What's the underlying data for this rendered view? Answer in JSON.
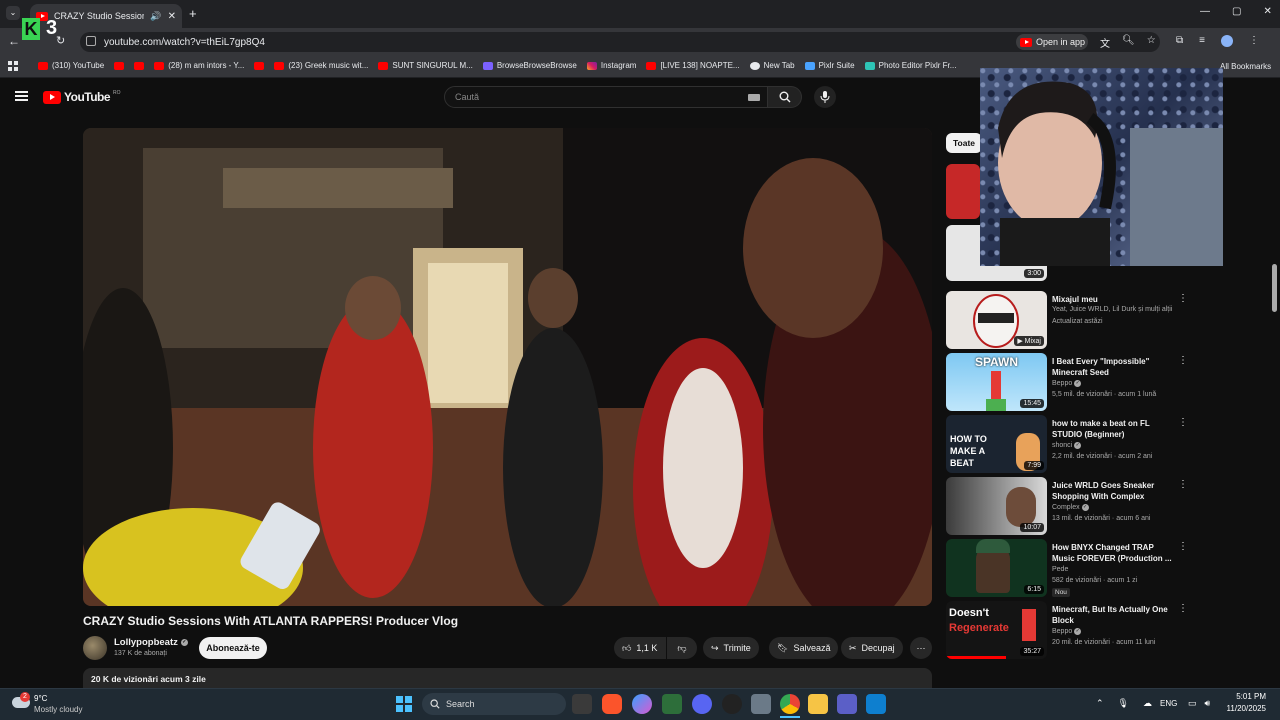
{
  "browser": {
    "tab_title": "CRAZY Studio Sessions With ...",
    "url": "youtube.com/watch?v=thEiL7gp8Q4",
    "open_in_app": "Open in app",
    "all_bookmarks": "All Bookmarks",
    "bookmarks": [
      {
        "label": "(310) YouTube",
        "icon": "youtube-icon"
      },
      {
        "label": "",
        "icon": "youtube-icon"
      },
      {
        "label": "",
        "icon": "youtube-icon"
      },
      {
        "label": "(28) m am intors - Y...",
        "icon": "youtube-icon"
      },
      {
        "label": "",
        "icon": "youtube-icon"
      },
      {
        "label": "(23) Greek music wit...",
        "icon": "youtube-icon"
      },
      {
        "label": "SUNT SINGURUL M...",
        "icon": "youtube-icon"
      },
      {
        "label": "BrowseBrowseBrowse",
        "icon": "browse-icon"
      },
      {
        "label": "Instagram",
        "icon": "instagram-icon"
      },
      {
        "label": "[LIVE 138] NOAPTE...",
        "icon": "youtube-icon"
      },
      {
        "label": "New Tab",
        "icon": "globe-icon"
      },
      {
        "label": "Pixlr Suite",
        "icon": "pixlr-icon"
      },
      {
        "label": "Photo Editor Pixlr Fr...",
        "icon": "pixlr-icon"
      }
    ]
  },
  "overlay": {
    "badge": "K",
    "number": "3"
  },
  "youtube": {
    "logo_text": "YouTube",
    "region": "RO",
    "search_placeholder": "Caută",
    "video": {
      "title": "CRAZY Studio Sessions With ATLANTA RAPPERS! Producer Vlog",
      "channel": "Lollypopbeatz",
      "subscribers": "137 K de abonați",
      "subscribe_label": "Abonează-te",
      "likes": "1,1 K",
      "share_label": "Trimite",
      "save_label": "Salvează",
      "clip_label": "Decupaj",
      "views_date": "20 K de vizionări  acum 3 zile"
    },
    "filter_chip": "Toate",
    "sidebar_hidden_duration": "3:00",
    "recommendations": [
      {
        "title": "Mixajul meu",
        "channel": "Yeat, Juice WRLD, Lil Durk și mulți alții",
        "meta": "Actualizat astăzi",
        "duration": "Mixaj",
        "verified": false,
        "badge": ""
      },
      {
        "title": "I Beat Every \"Impossible\" Minecraft Seed",
        "channel": "Beppo",
        "meta": "5,5 mil. de vizionări · acum 1 lună",
        "duration": "15:45",
        "verified": true,
        "badge": ""
      },
      {
        "title": "how to make a beat on FL STUDIO (Beginner)",
        "channel": "shonci",
        "meta": "2,2 mil. de vizionări · acum 2 ani",
        "duration": "7:99",
        "verified": true,
        "badge": ""
      },
      {
        "title": "Juice WRLD Goes Sneaker Shopping With Complex",
        "channel": "Complex",
        "meta": "13 mil. de vizionări · acum 6 ani",
        "duration": "10:07",
        "verified": true,
        "badge": ""
      },
      {
        "title": "How BNYX Changed TRAP Music FOREVER (Production ...",
        "channel": "Pede",
        "meta": "582 de vizionări · acum 1 zi",
        "duration": "6:15",
        "verified": false,
        "badge": "Nou"
      },
      {
        "title": "Minecraft, But Its Actually One Block",
        "channel": "Beppo",
        "meta": "20 mil. de vizionări · acum 11 luni",
        "duration": "35:27",
        "verified": true,
        "badge": ""
      }
    ],
    "thumb_texts": {
      "spawn": "SPAWN",
      "how_to": "HOW TO MAKE A BEAT",
      "doesnt": "Doesn't",
      "regenerate": "Regenerate"
    }
  },
  "taskbar": {
    "weather_temp": "9°C",
    "weather_desc": "Mostly cloudy",
    "weather_badge": "2",
    "search_label": "Search",
    "lang": "ENG",
    "time": "5:01 PM",
    "date": "11/20/2025"
  }
}
